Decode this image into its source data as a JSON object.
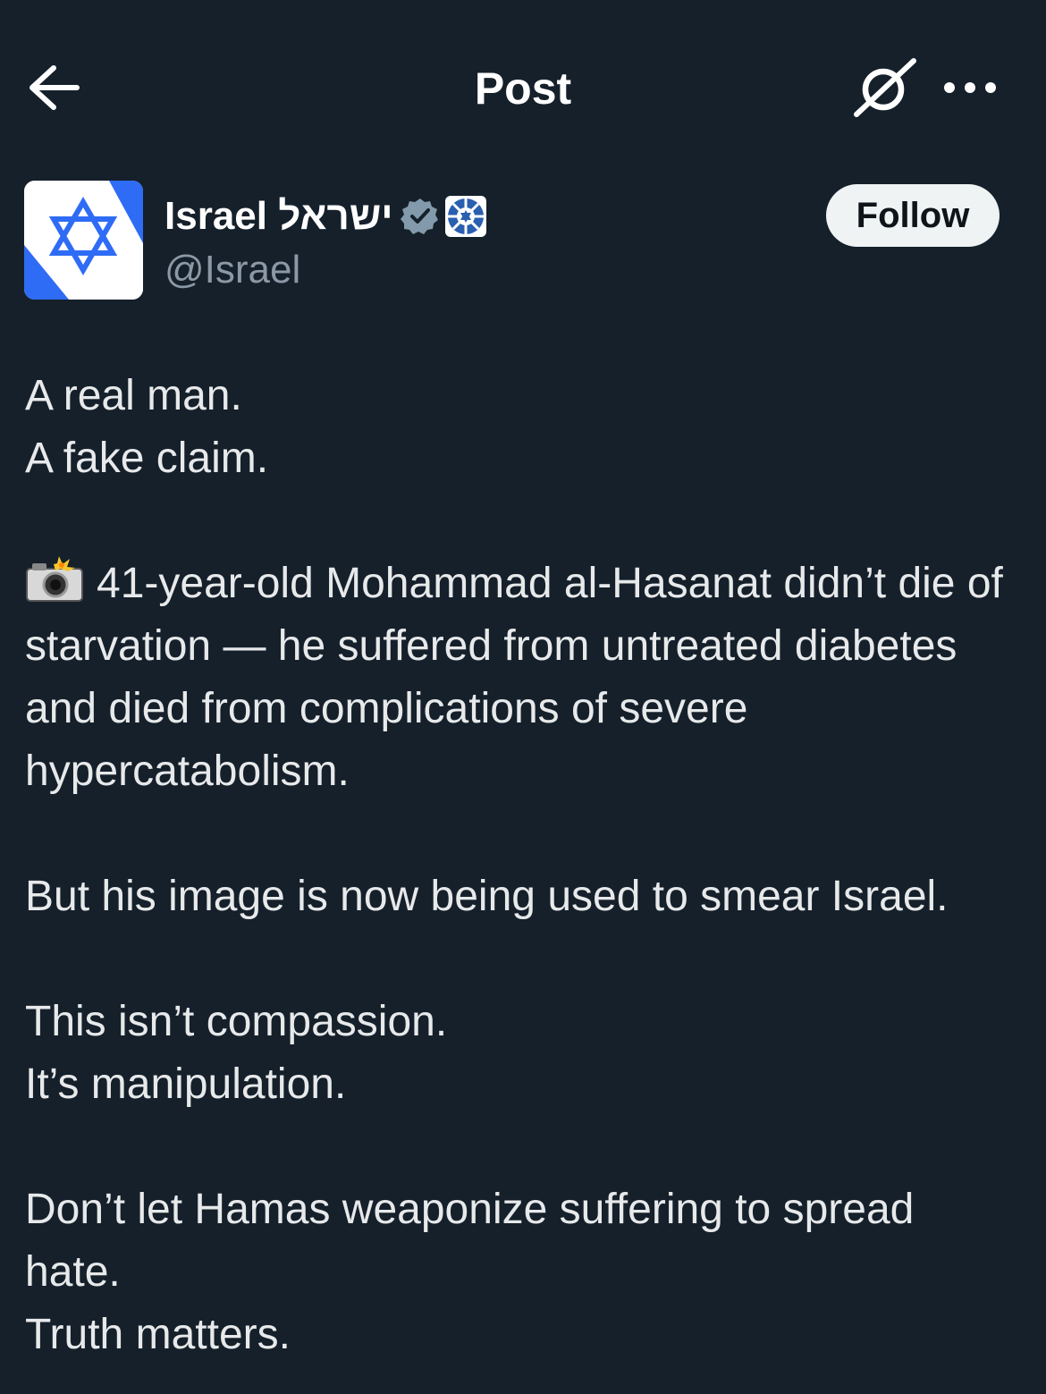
{
  "header": {
    "title": "Post",
    "back_icon": "arrow-left-icon",
    "grok_icon": "grok-icon",
    "more_icon": "ellipsis-icon"
  },
  "author": {
    "display_name": "Israel ישראל",
    "handle": "@Israel",
    "verified_icon": "verified-badge-icon",
    "affiliation_icon": "government-badge-icon",
    "avatar_icon": "star-of-david-icon"
  },
  "follow_label": "Follow",
  "post": {
    "line_1": "A real man.",
    "line_2": "A fake claim.",
    "emoji_icon": "camera-flash-icon",
    "paragraph_2": "41-year-old Mohammad al-Hasanat didn’t die of starvation — he suffered from untreated diabetes and died from complications of severe hypercatabolism.",
    "paragraph_3": "But his image is now being used to smear Israel.",
    "line_4a": "This isn’t compassion.",
    "line_4b": "It’s manipulation.",
    "line_5a": "Don’t let Hamas weaponize suffering to spread hate.",
    "line_5b": "Truth matters."
  },
  "colors": {
    "background": "#15202b",
    "text": "#e7e9ea",
    "secondary_text": "#8b98a5",
    "flag_blue": "#2f6cf6",
    "follow_bg": "#eff3f4"
  }
}
